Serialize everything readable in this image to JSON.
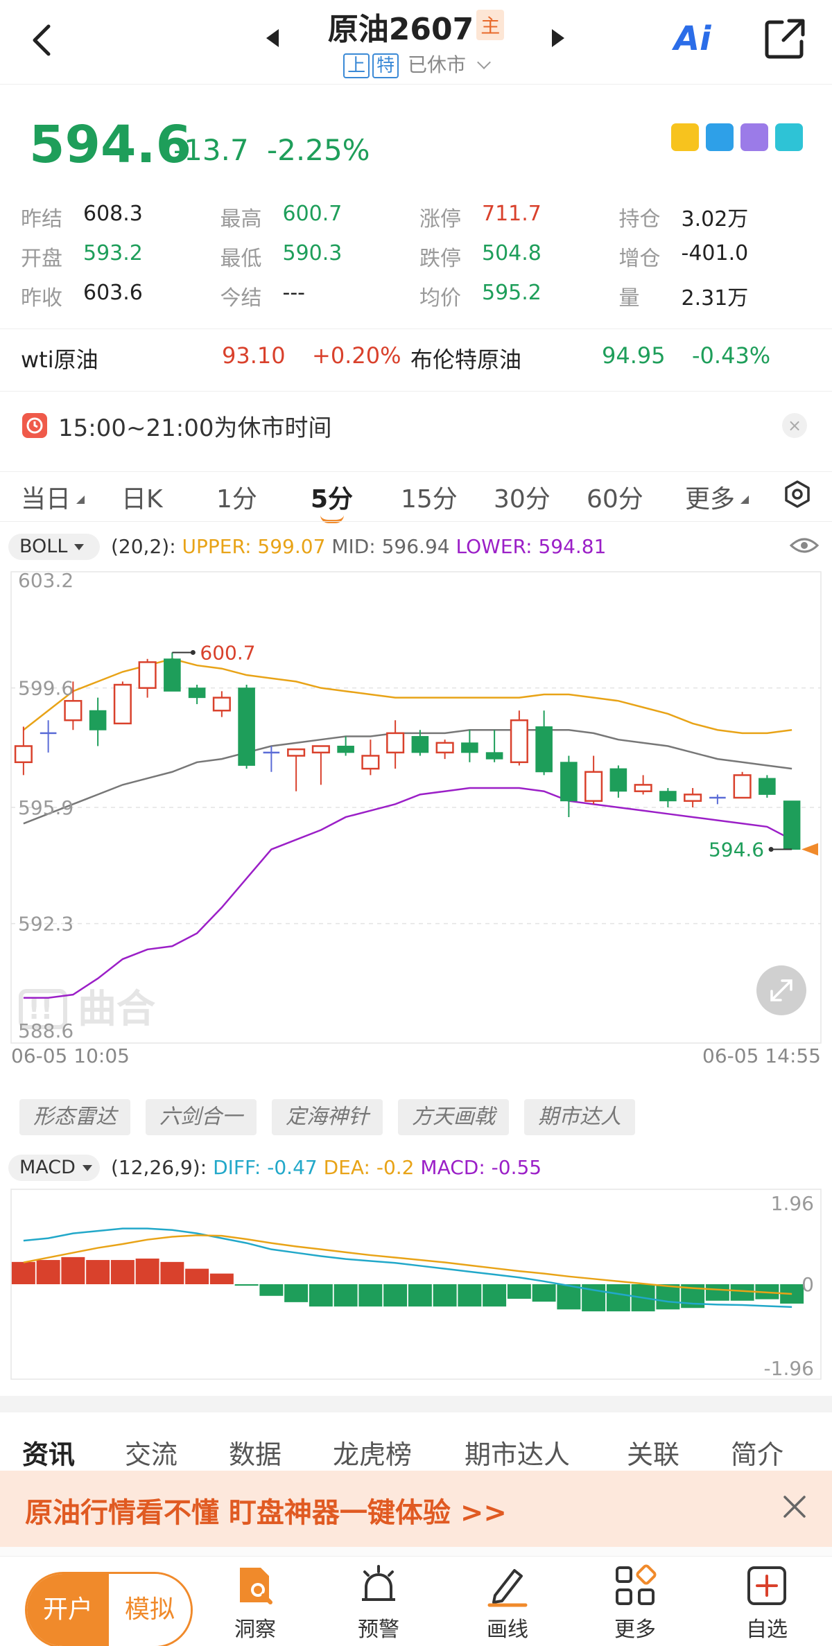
{
  "header": {
    "title": "原油2607",
    "main_badge": "主",
    "tag_shang": "上",
    "tag_te": "特",
    "status": "已休市",
    "ai_label": "Ai"
  },
  "quote": {
    "price": "594.6",
    "change": "-13.7",
    "change_pct": "-2.25%"
  },
  "stats": [
    [
      {
        "label": "昨结",
        "value": "608.3",
        "color": "normal"
      },
      {
        "label": "最高",
        "value": "600.7",
        "color": "green"
      },
      {
        "label": "涨停",
        "value": "711.7",
        "color": "red"
      },
      {
        "label": "持仓",
        "value": "3.02万",
        "color": "normal"
      }
    ],
    [
      {
        "label": "开盘",
        "value": "593.2",
        "color": "green"
      },
      {
        "label": "最低",
        "value": "590.3",
        "color": "green"
      },
      {
        "label": "跌停",
        "value": "504.8",
        "color": "green"
      },
      {
        "label": "增仓",
        "value": "-401.0",
        "color": "normal"
      }
    ],
    [
      {
        "label": "昨收",
        "value": "603.6",
        "color": "normal"
      },
      {
        "label": "今结",
        "value": "---",
        "color": "normal"
      },
      {
        "label": "均价",
        "value": "595.2",
        "color": "green"
      },
      {
        "label": "量",
        "value": "2.31万",
        "color": "normal"
      }
    ]
  ],
  "related": {
    "wti_name": "wti原油",
    "wti_price": "93.10",
    "wti_pct": "+0.20%",
    "brent_name": "布伦特原油",
    "brent_price": "94.95",
    "brent_pct": "-0.43%"
  },
  "notice": {
    "text": "15:00~21:00为休市时间"
  },
  "period_tabs": [
    "当日",
    "日K",
    "1分",
    "5分",
    "15分",
    "30分",
    "60分",
    "更多"
  ],
  "active_period": "5分",
  "boll": {
    "pill": "BOLL",
    "params": "(20,2):",
    "upper": "UPPER: 599.07",
    "mid": "MID: 596.94",
    "lower": "LOWER: 594.81"
  },
  "chart_axis": {
    "y_top": "603.2",
    "y_2": "599.6",
    "y_3": "595.9",
    "y_4": "592.3",
    "y_bottom": "588.6",
    "x_start": "06-05 10:05",
    "x_end": "06-05 14:55",
    "high_marker": "600.7",
    "last_marker": "594.6",
    "watermark": "曲合"
  },
  "chips": [
    "形态雷达",
    "六剑合一",
    "定海神针",
    "方天画戟",
    "期市达人"
  ],
  "macd": {
    "pill": "MACD",
    "params": "(12,26,9):",
    "diff": "DIFF: -0.47",
    "dea": "DEA: -0.2",
    "macd": "MACD: -0.55",
    "y_top": "1.96",
    "y_mid": "0",
    "y_bottom": "-1.96"
  },
  "news_tabs": [
    "资讯",
    "交流",
    "数据",
    "龙虎榜",
    "期市达人",
    "关联",
    "简介"
  ],
  "promo": {
    "text": "原油行情看不懂  盯盘神器一键体验 >>"
  },
  "bottom_nav": {
    "open": "开户",
    "demo": "模拟",
    "items": [
      "洞察",
      "预警",
      "画线",
      "更多",
      "自选"
    ]
  },
  "colors": {
    "up": "#d9412c",
    "down": "#1e9e5a",
    "upper": "#e8a317",
    "mid": "#777777",
    "lower": "#9b1fc7",
    "diff": "#22a8c9",
    "dea": "#e8a317",
    "accent": "#f08a2b"
  },
  "chart_data": {
    "type": "candlestick",
    "interval": "5分",
    "ylim": [
      588.6,
      603.2
    ],
    "x_range": [
      "06-05 10:05",
      "06-05 14:55"
    ],
    "candles": [
      {
        "o": 597.3,
        "h": 598.4,
        "l": 596.9,
        "c": 597.8
      },
      {
        "o": 598.2,
        "h": 598.6,
        "l": 597.6,
        "c": 598.2
      },
      {
        "o": 598.6,
        "h": 599.8,
        "l": 598.3,
        "c": 599.2
      },
      {
        "o": 598.9,
        "h": 599.3,
        "l": 597.8,
        "c": 598.3
      },
      {
        "o": 598.5,
        "h": 599.8,
        "l": 598.5,
        "c": 599.7
      },
      {
        "o": 599.6,
        "h": 600.5,
        "l": 599.3,
        "c": 600.4
      },
      {
        "o": 600.5,
        "h": 600.7,
        "l": 599.5,
        "c": 599.5
      },
      {
        "o": 599.6,
        "h": 599.7,
        "l": 599.1,
        "c": 599.3
      },
      {
        "o": 598.9,
        "h": 599.5,
        "l": 598.7,
        "c": 599.3
      },
      {
        "o": 599.6,
        "h": 599.7,
        "l": 597.1,
        "c": 597.2
      },
      {
        "o": 597.6,
        "h": 597.8,
        "l": 597.0,
        "c": 597.6
      },
      {
        "o": 597.5,
        "h": 597.7,
        "l": 596.4,
        "c": 597.7
      },
      {
        "o": 597.6,
        "h": 597.8,
        "l": 596.6,
        "c": 597.8
      },
      {
        "o": 597.8,
        "h": 598.1,
        "l": 597.5,
        "c": 597.6
      },
      {
        "o": 597.1,
        "h": 598.0,
        "l": 596.9,
        "c": 597.5
      },
      {
        "o": 597.6,
        "h": 598.6,
        "l": 597.1,
        "c": 598.2
      },
      {
        "o": 598.1,
        "h": 598.3,
        "l": 597.5,
        "c": 597.6
      },
      {
        "o": 597.6,
        "h": 598.0,
        "l": 597.4,
        "c": 597.9
      },
      {
        "o": 597.9,
        "h": 598.3,
        "l": 597.3,
        "c": 597.6
      },
      {
        "o": 597.6,
        "h": 598.3,
        "l": 597.3,
        "c": 597.4
      },
      {
        "o": 597.3,
        "h": 598.9,
        "l": 597.2,
        "c": 598.6
      },
      {
        "o": 598.4,
        "h": 598.9,
        "l": 596.9,
        "c": 597.0
      },
      {
        "o": 597.3,
        "h": 597.5,
        "l": 595.6,
        "c": 596.1
      },
      {
        "o": 596.1,
        "h": 597.5,
        "l": 596.0,
        "c": 597.0
      },
      {
        "o": 597.1,
        "h": 597.2,
        "l": 596.2,
        "c": 596.4
      },
      {
        "o": 596.4,
        "h": 596.9,
        "l": 596.3,
        "c": 596.6
      },
      {
        "o": 596.4,
        "h": 596.5,
        "l": 595.9,
        "c": 596.1
      },
      {
        "o": 596.1,
        "h": 596.5,
        "l": 595.9,
        "c": 596.3
      },
      {
        "o": 596.2,
        "h": 596.3,
        "l": 596.0,
        "c": 596.2
      },
      {
        "o": 596.2,
        "h": 597.0,
        "l": 596.2,
        "c": 596.9
      },
      {
        "o": 596.8,
        "h": 596.9,
        "l": 596.2,
        "c": 596.3
      },
      {
        "o": 596.1,
        "h": 596.1,
        "l": 594.6,
        "c": 594.6
      }
    ],
    "upper": [
      598.3,
      598.9,
      599.5,
      599.8,
      600.1,
      600.3,
      600.5,
      600.3,
      600.2,
      600.0,
      599.9,
      599.8,
      599.6,
      599.5,
      599.4,
      599.3,
      599.3,
      599.3,
      599.3,
      599.3,
      599.3,
      599.4,
      599.4,
      599.3,
      599.2,
      599.0,
      598.8,
      598.5,
      598.3,
      598.2,
      598.2,
      598.3
    ],
    "mid": [
      595.4,
      595.7,
      596.0,
      596.3,
      596.6,
      596.8,
      597.0,
      597.3,
      597.4,
      597.6,
      597.8,
      597.9,
      598.0,
      598.1,
      598.1,
      598.2,
      598.2,
      598.2,
      598.3,
      598.3,
      598.3,
      598.3,
      598.3,
      598.2,
      598.0,
      597.9,
      597.8,
      597.6,
      597.4,
      597.3,
      597.2,
      597.1
    ],
    "lower": [
      590.0,
      590.0,
      590.1,
      590.6,
      591.2,
      591.5,
      591.6,
      592.0,
      592.8,
      593.7,
      594.6,
      594.9,
      595.2,
      595.6,
      595.8,
      596.0,
      596.3,
      596.4,
      596.5,
      596.5,
      596.5,
      596.4,
      596.1,
      596.0,
      595.9,
      595.8,
      595.7,
      595.6,
      595.5,
      595.4,
      595.3,
      594.9
    ],
    "macd_hist": [
      0.46,
      0.5,
      0.56,
      0.5,
      0.5,
      0.53,
      0.46,
      0.32,
      0.22,
      -0.03,
      -0.24,
      -0.37,
      -0.46,
      -0.46,
      -0.46,
      -0.46,
      -0.46,
      -0.46,
      -0.46,
      -0.46,
      -0.3,
      -0.36,
      -0.52,
      -0.56,
      -0.56,
      -0.56,
      -0.52,
      -0.49,
      -0.34,
      -0.34,
      -0.31,
      -0.4
    ],
    "diff": [
      0.9,
      0.95,
      1.05,
      1.1,
      1.15,
      1.15,
      1.12,
      1.05,
      0.95,
      0.85,
      0.72,
      0.65,
      0.58,
      0.52,
      0.48,
      0.44,
      0.38,
      0.32,
      0.26,
      0.2,
      0.14,
      0.06,
      -0.03,
      -0.12,
      -0.2,
      -0.28,
      -0.36,
      -0.4,
      -0.42,
      -0.43,
      -0.45,
      -0.47
    ],
    "dea": [
      0.45,
      0.55,
      0.65,
      0.75,
      0.83,
      0.92,
      0.98,
      1.01,
      1.0,
      0.93,
      0.85,
      0.78,
      0.72,
      0.66,
      0.6,
      0.55,
      0.5,
      0.45,
      0.39,
      0.33,
      0.27,
      0.22,
      0.16,
      0.11,
      0.06,
      0.01,
      -0.04,
      -0.08,
      -0.11,
      -0.14,
      -0.17,
      -0.2
    ],
    "macd_ylim": [
      -1.96,
      1.96
    ]
  }
}
